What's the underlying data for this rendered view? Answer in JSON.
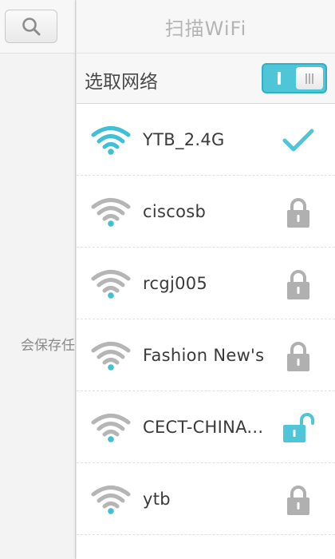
{
  "left": {
    "search_icon": "search-icon",
    "partial_text": "会保存任"
  },
  "header": {
    "title": "扫描WiFi"
  },
  "select_network": {
    "label": "选取网络",
    "toggle_on": true
  },
  "colors": {
    "accent": "#4ec6d8",
    "signal_on": "#3fc0d4",
    "signal_off": "#b5b5b5",
    "lock_gray": "#b0b0b0"
  },
  "networks": [
    {
      "ssid": "YTB_2.4G",
      "status": "connected-check-icon",
      "signal_bars": 4
    },
    {
      "ssid": "ciscosb",
      "status": "lock-icon",
      "signal_bars": 1
    },
    {
      "ssid": "rcgj005",
      "status": "lock-icon",
      "signal_bars": 1
    },
    {
      "ssid": "Fashion New's",
      "status": "lock-icon",
      "signal_bars": 1
    },
    {
      "ssid": "CECT-CHINA...",
      "status": "unlock-icon",
      "signal_bars": 1
    },
    {
      "ssid": "ytb",
      "status": "lock-icon",
      "signal_bars": 1
    }
  ]
}
